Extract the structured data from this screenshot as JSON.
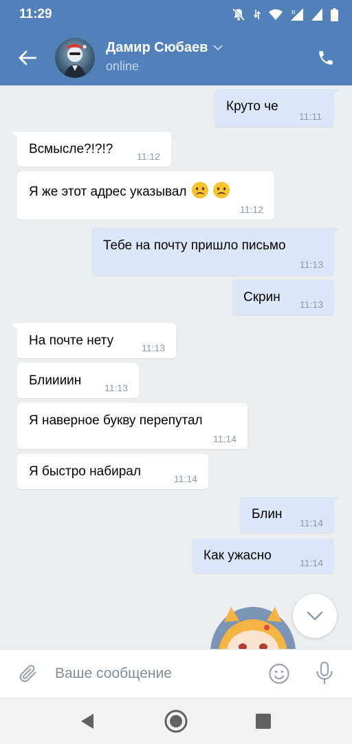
{
  "status_bar": {
    "time": "11:29",
    "icons": [
      "bell-off-icon",
      "data-arrows-icon",
      "wifi-icon",
      "signal-roaming-icon",
      "signal-icon",
      "battery-icon"
    ]
  },
  "header": {
    "contact_name": "Дамир Сюбаев",
    "contact_status": "online",
    "icons": {
      "back": "back-arrow-icon",
      "dropdown": "chevron-down-icon",
      "call": "phone-icon"
    }
  },
  "messages": [
    {
      "direction": "out",
      "text": "Круто че",
      "time": "11:11"
    },
    {
      "direction": "in",
      "text": "Всмысле?!?!?",
      "time": "11:12"
    },
    {
      "direction": "in",
      "text": "Я же этот адрес указывал",
      "time": "11:12",
      "emoji": [
        "frowning-face-emoji",
        "frowning-face-emoji"
      ]
    },
    {
      "direction": "out",
      "text": "Тебе на почту пришло письмо",
      "time": "11:13"
    },
    {
      "direction": "out",
      "text": "Скрин",
      "time": "11:13"
    },
    {
      "direction": "in",
      "text": "На почте нету",
      "time": "11:13"
    },
    {
      "direction": "in",
      "text": "Блиииин",
      "time": "11:13"
    },
    {
      "direction": "in",
      "text": "Я наверное букву перепутал",
      "time": "11:14"
    },
    {
      "direction": "in",
      "text": "Я быстро набирал",
      "time": "11:14"
    },
    {
      "direction": "out",
      "text": "Блин",
      "time": "11:14"
    },
    {
      "direction": "out",
      "text": "Как ужасно",
      "time": "11:14"
    }
  ],
  "composer": {
    "placeholder": "Ваше сообщение",
    "value": "",
    "icons": {
      "attach": "paperclip-icon",
      "emoji": "smiley-icon",
      "mic": "microphone-icon"
    }
  },
  "scroll_down_icon": "chevron-down-icon",
  "nav_bar": {
    "icons": [
      "nav-back-icon",
      "nav-home-icon",
      "nav-recents-icon"
    ]
  },
  "colors": {
    "header": "#5181b8",
    "chat_background": "#edeef0",
    "incoming_bubble": "#ffffff",
    "outgoing_bubble": "#dbe7f7",
    "timestamp": "#8c9aab"
  }
}
